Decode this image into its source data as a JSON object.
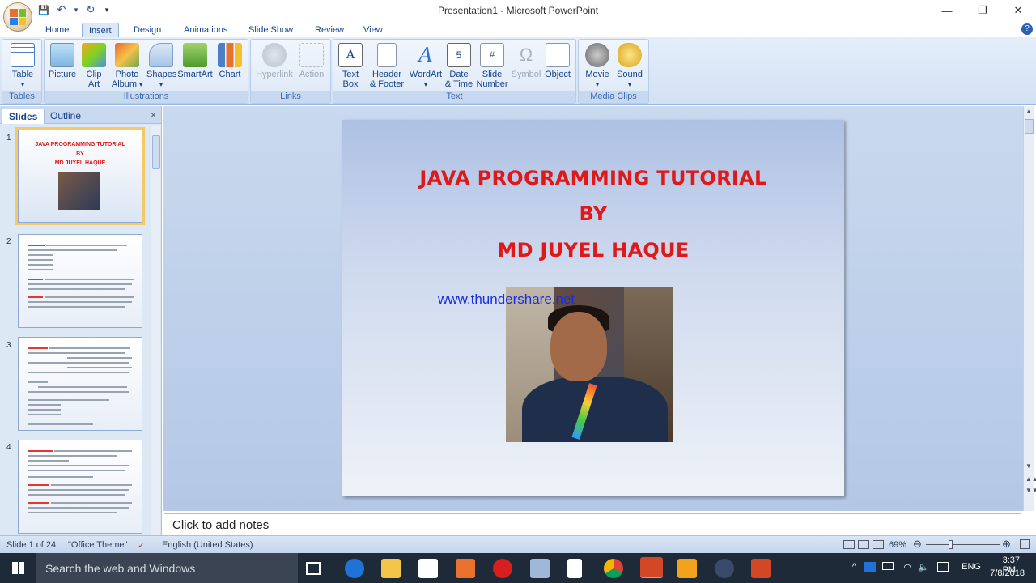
{
  "window": {
    "title": "Presentation1 - Microsoft PowerPoint",
    "minimize": "—",
    "restore": "❐",
    "close": "✕"
  },
  "qat": {
    "save": "💾",
    "undo": "↶",
    "dropdown1": "▾",
    "redo": "↻",
    "customize": "▾"
  },
  "tabs": [
    {
      "label": "Home"
    },
    {
      "label": "Insert"
    },
    {
      "label": "Design"
    },
    {
      "label": "Animations"
    },
    {
      "label": "Slide Show"
    },
    {
      "label": "Review"
    },
    {
      "label": "View"
    }
  ],
  "active_tab": "Insert",
  "help_glyph": "?",
  "ribbon": {
    "groups": {
      "tables": "Tables",
      "illustrations": "Illustrations",
      "links": "Links",
      "text": "Text",
      "media": "Media Clips"
    },
    "buttons": {
      "table": "Table",
      "picture": "Picture",
      "clip_art_1": "Clip",
      "clip_art_2": "Art",
      "photo_album_1": "Photo",
      "photo_album_2": "Album",
      "shapes": "Shapes",
      "smartart": "SmartArt",
      "chart": "Chart",
      "hyperlink": "Hyperlink",
      "action": "Action",
      "text_box_1": "Text",
      "text_box_2": "Box",
      "header_footer_1": "Header",
      "header_footer_2": "& Footer",
      "wordart": "WordArt",
      "date_time_1": "Date",
      "date_time_2": "& Time",
      "slide_number_1": "Slide",
      "slide_number_2": "Number",
      "symbol": "Symbol",
      "object": "Object",
      "movie": "Movie",
      "sound": "Sound"
    }
  },
  "left_pane": {
    "tabs": [
      "Slides",
      "Outline"
    ],
    "close": "×",
    "thumb_numbers": [
      "1",
      "2",
      "3",
      "4"
    ],
    "thumb1": {
      "line1": "JAVA PROGRAMMING TUTORIAL",
      "line2": "BY",
      "line3": "MD JUYEL HAQUE"
    }
  },
  "slide": {
    "title_line1": "JAVA PROGRAMMING TUTORIAL",
    "title_line2": "BY",
    "title_line3": "MD JUYEL HAQUE",
    "watermark": "www.thundershare.net"
  },
  "notes": {
    "placeholder": "Click to add notes"
  },
  "status": {
    "slide": "Slide 1 of 24",
    "theme": "\"Office Theme\"",
    "language": "English (United States)",
    "zoom": "69%"
  },
  "taskbar": {
    "search_placeholder": "Search the web and Windows",
    "lang": "ENG",
    "time": "3:37 PM",
    "date": "7/8/2018"
  },
  "colors": {
    "slide_title": "#e01818",
    "watermark": "#1a2ee0",
    "ribbon_text": "#15428b"
  }
}
